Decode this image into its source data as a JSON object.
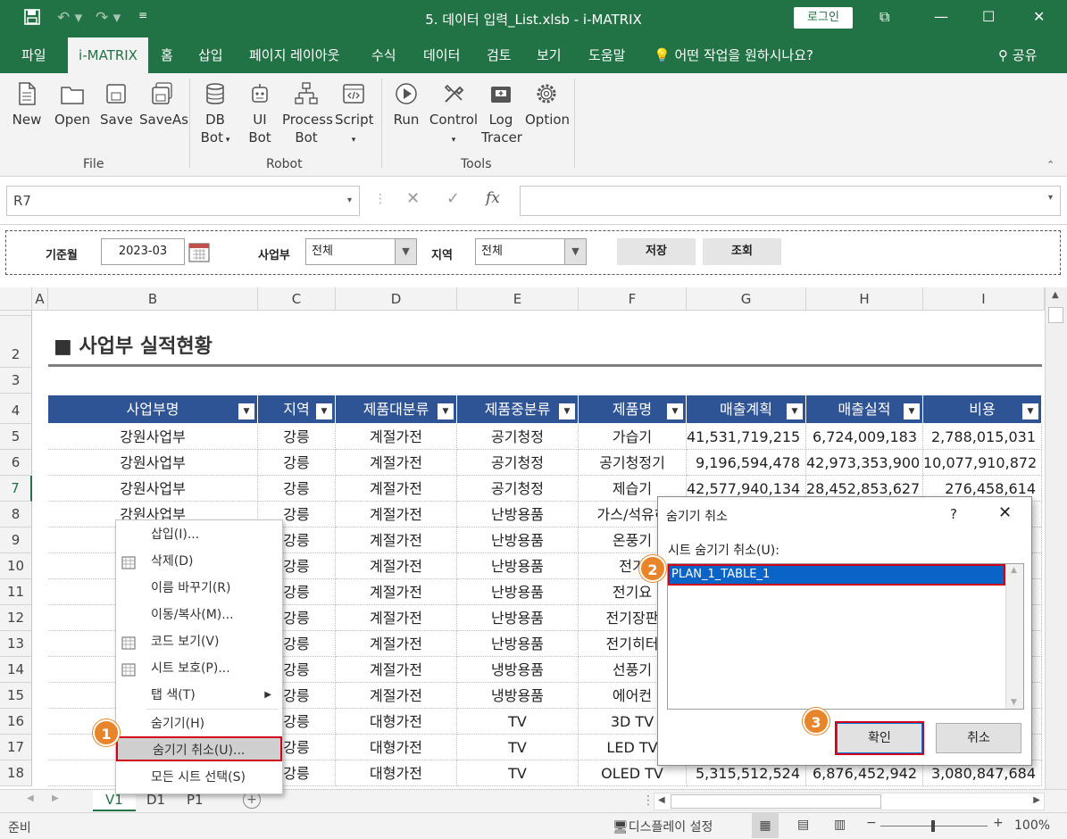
{
  "window": {
    "title": "5. 데이터 입력_List.xlsb  -  i-MATRIX",
    "login_label": "로그인"
  },
  "tabs": [
    "파일",
    "i-MATRIX",
    "홈",
    "삽입",
    "페이지 레이아웃",
    "수식",
    "데이터",
    "검토",
    "보기",
    "도움말",
    "어떤 작업을 원하시나요?"
  ],
  "share_label": "공유",
  "ribbon": {
    "file_group": {
      "label": "File",
      "buttons": [
        "New",
        "Open",
        "Save",
        "SaveAs"
      ]
    },
    "robot_group": {
      "label": "Robot",
      "buttons": [
        "DB\nBot",
        "UI\nBot",
        "Process\nBot",
        "Script"
      ]
    },
    "tools_group": {
      "label": "Tools",
      "buttons": [
        "Run",
        "Control",
        "Log\nTracer",
        "Option"
      ]
    }
  },
  "namebox": "R7",
  "filter": {
    "month_label": "기준월",
    "month_value": "2023-03",
    "division_label": "사업부",
    "division_value": "전체",
    "region_label": "지역",
    "region_value": "전체",
    "save_btn": "저장",
    "search_btn": "조회"
  },
  "columns": [
    "A",
    "B",
    "C",
    "D",
    "E",
    "F",
    "G",
    "H",
    "I"
  ],
  "rows": [
    "2",
    "3",
    "4",
    "5",
    "6",
    "7",
    "8",
    "9",
    "10",
    "11",
    "12",
    "13",
    "14",
    "15",
    "16",
    "17",
    "18"
  ],
  "sheet_title": "사업부 실적현황",
  "table": {
    "headers": [
      "사업부명",
      "지역",
      "제품대분류",
      "제품중분류",
      "제품명",
      "매출계획",
      "매출실적",
      "비용"
    ],
    "rows": [
      [
        "강원사업부",
        "강릉",
        "계절가전",
        "공기청정",
        "가습기",
        "41,531,719,215",
        "6,724,009,183",
        "2,788,015,031"
      ],
      [
        "강원사업부",
        "강릉",
        "계절가전",
        "공기청정",
        "공기청정기",
        "9,196,594,478",
        "42,973,353,900",
        "10,077,910,872"
      ],
      [
        "강원사업부",
        "강릉",
        "계절가전",
        "공기청정",
        "제습기",
        "42,577,940,134",
        "28,452,853,627",
        "276,458,614"
      ],
      [
        "강원사업부",
        "강릉",
        "계절가전",
        "난방용품",
        "가스/석유히",
        "",
        "",
        ""
      ],
      [
        "",
        "강릉",
        "계절가전",
        "난방용품",
        "온풍기",
        "",
        "",
        ""
      ],
      [
        "",
        "강릉",
        "계절가전",
        "난방용품",
        "전기",
        "",
        "",
        ""
      ],
      [
        "",
        "강릉",
        "계절가전",
        "난방용품",
        "전기요",
        "",
        "",
        ""
      ],
      [
        "",
        "강릉",
        "계절가전",
        "난방용품",
        "전기장판",
        "",
        "",
        ""
      ],
      [
        "",
        "강릉",
        "계절가전",
        "난방용품",
        "전기히터",
        "",
        "",
        ""
      ],
      [
        "",
        "강릉",
        "계절가전",
        "냉방용품",
        "선풍기",
        "",
        "",
        ""
      ],
      [
        "",
        "강릉",
        "계절가전",
        "냉방용품",
        "에어컨",
        "",
        "",
        ""
      ],
      [
        "",
        "강릉",
        "대형가전",
        "TV",
        "3D TV",
        "",
        "",
        ""
      ],
      [
        "",
        "강릉",
        "대형가전",
        "TV",
        "LED TV",
        "",
        "",
        ""
      ],
      [
        "",
        "강릉",
        "대형가전",
        "TV",
        "OLED TV",
        "5,315,512,524",
        "6,876,452,942",
        "3,080,847,684"
      ]
    ]
  },
  "context_menu": [
    {
      "label": "삽입(I)...",
      "icon": ""
    },
    {
      "label": "삭제(D)",
      "icon": "delete-sheet-icon"
    },
    {
      "label": "이름 바꾸기(R)",
      "icon": ""
    },
    {
      "label": "이동/복사(M)...",
      "icon": ""
    },
    {
      "label": "코드 보기(V)",
      "icon": "view-code-icon"
    },
    {
      "label": "시트 보호(P)...",
      "icon": "protect-sheet-icon"
    },
    {
      "label": "탭 색(T)",
      "icon": ""
    },
    {
      "label": "숨기기(H)",
      "icon": ""
    },
    {
      "label": "숨기기 취소(U)...",
      "icon": ""
    },
    {
      "label": "모든 시트 선택(S)",
      "icon": ""
    }
  ],
  "dialog": {
    "title": "숨기기 취소",
    "help": "?",
    "list_label": "시트 숨기기 취소(U):",
    "items": [
      "PLAN_1_TABLE_1"
    ],
    "ok": "확인",
    "cancel": "취소"
  },
  "badges": [
    "1",
    "2",
    "3"
  ],
  "sheet_tabs": [
    "V1",
    "D1",
    "P1"
  ],
  "status": {
    "ready": "준비",
    "display_settings": "디스플레이 설정",
    "zoom": "100%"
  },
  "colors": {
    "brand": "#217346",
    "header": "#2f5496",
    "highlight": "#d0021b",
    "badge": "#e8852a",
    "selection": "#0a64c8"
  }
}
